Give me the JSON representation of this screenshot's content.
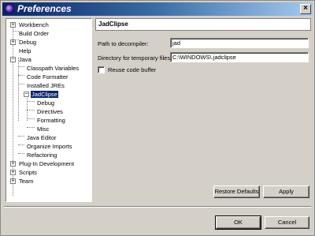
{
  "window": {
    "title": "Preferences",
    "close_glyph": "×"
  },
  "tree": {
    "items": [
      {
        "label": "Workbench",
        "expander": "+"
      },
      {
        "label": "Build Order"
      },
      {
        "label": "Debug",
        "expander": "+"
      },
      {
        "label": "Help"
      },
      {
        "label": "Java",
        "expander": "−"
      },
      {
        "label": "Classpath Variables"
      },
      {
        "label": "Code Formatter"
      },
      {
        "label": "Installed JREs"
      },
      {
        "label": "JadClipse",
        "expander": "−",
        "selected": true
      },
      {
        "label": "Debug"
      },
      {
        "label": "Directives"
      },
      {
        "label": "Formatting"
      },
      {
        "label": "Misc"
      },
      {
        "label": "Java Editor"
      },
      {
        "label": "Organize Imports"
      },
      {
        "label": "Refactoring"
      },
      {
        "label": "Plug-In Development",
        "expander": "+"
      },
      {
        "label": "Scripts",
        "expander": "+"
      },
      {
        "label": "Team",
        "expander": "+"
      }
    ]
  },
  "panel": {
    "title": "JadClipse",
    "decompiler_label": "Path to decompiler:",
    "decompiler_value": "jad",
    "tempdir_label": "Directory for temporary files:",
    "tempdir_value": "C:\\WINDOWS\\.jadclipse",
    "reuse_label": "Reuse code buffer",
    "reuse_checked": false
  },
  "buttons": {
    "restore_defaults": "Restore Defaults",
    "apply": "Apply",
    "ok": "OK",
    "cancel": "Cancel"
  }
}
